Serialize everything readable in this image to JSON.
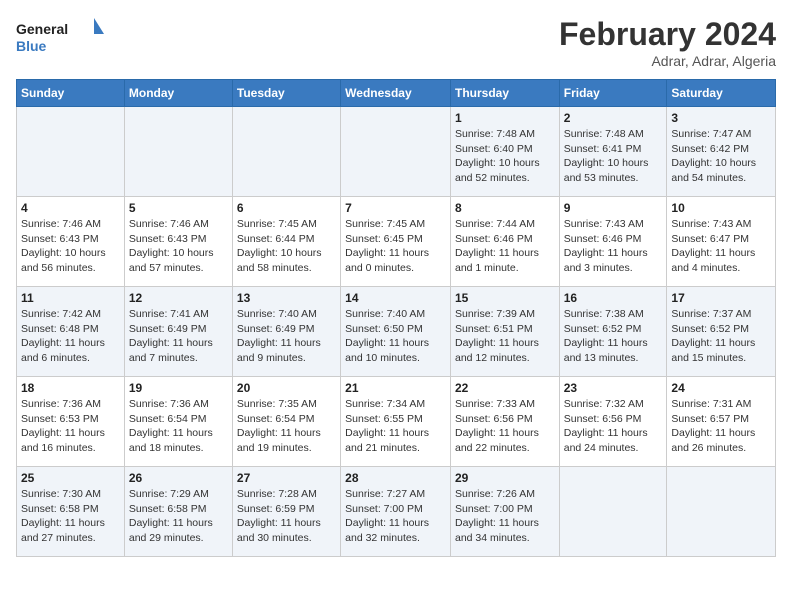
{
  "header": {
    "logo_text_general": "General",
    "logo_text_blue": "Blue",
    "month_title": "February 2024",
    "location": "Adrar, Adrar, Algeria"
  },
  "days_of_week": [
    "Sunday",
    "Monday",
    "Tuesday",
    "Wednesday",
    "Thursday",
    "Friday",
    "Saturday"
  ],
  "weeks": [
    [
      {
        "day": "",
        "info": ""
      },
      {
        "day": "",
        "info": ""
      },
      {
        "day": "",
        "info": ""
      },
      {
        "day": "",
        "info": ""
      },
      {
        "day": "1",
        "info": "Sunrise: 7:48 AM\nSunset: 6:40 PM\nDaylight: 10 hours and 52 minutes."
      },
      {
        "day": "2",
        "info": "Sunrise: 7:48 AM\nSunset: 6:41 PM\nDaylight: 10 hours and 53 minutes."
      },
      {
        "day": "3",
        "info": "Sunrise: 7:47 AM\nSunset: 6:42 PM\nDaylight: 10 hours and 54 minutes."
      }
    ],
    [
      {
        "day": "4",
        "info": "Sunrise: 7:46 AM\nSunset: 6:43 PM\nDaylight: 10 hours and 56 minutes."
      },
      {
        "day": "5",
        "info": "Sunrise: 7:46 AM\nSunset: 6:43 PM\nDaylight: 10 hours and 57 minutes."
      },
      {
        "day": "6",
        "info": "Sunrise: 7:45 AM\nSunset: 6:44 PM\nDaylight: 10 hours and 58 minutes."
      },
      {
        "day": "7",
        "info": "Sunrise: 7:45 AM\nSunset: 6:45 PM\nDaylight: 11 hours and 0 minutes."
      },
      {
        "day": "8",
        "info": "Sunrise: 7:44 AM\nSunset: 6:46 PM\nDaylight: 11 hours and 1 minute."
      },
      {
        "day": "9",
        "info": "Sunrise: 7:43 AM\nSunset: 6:46 PM\nDaylight: 11 hours and 3 minutes."
      },
      {
        "day": "10",
        "info": "Sunrise: 7:43 AM\nSunset: 6:47 PM\nDaylight: 11 hours and 4 minutes."
      }
    ],
    [
      {
        "day": "11",
        "info": "Sunrise: 7:42 AM\nSunset: 6:48 PM\nDaylight: 11 hours and 6 minutes."
      },
      {
        "day": "12",
        "info": "Sunrise: 7:41 AM\nSunset: 6:49 PM\nDaylight: 11 hours and 7 minutes."
      },
      {
        "day": "13",
        "info": "Sunrise: 7:40 AM\nSunset: 6:49 PM\nDaylight: 11 hours and 9 minutes."
      },
      {
        "day": "14",
        "info": "Sunrise: 7:40 AM\nSunset: 6:50 PM\nDaylight: 11 hours and 10 minutes."
      },
      {
        "day": "15",
        "info": "Sunrise: 7:39 AM\nSunset: 6:51 PM\nDaylight: 11 hours and 12 minutes."
      },
      {
        "day": "16",
        "info": "Sunrise: 7:38 AM\nSunset: 6:52 PM\nDaylight: 11 hours and 13 minutes."
      },
      {
        "day": "17",
        "info": "Sunrise: 7:37 AM\nSunset: 6:52 PM\nDaylight: 11 hours and 15 minutes."
      }
    ],
    [
      {
        "day": "18",
        "info": "Sunrise: 7:36 AM\nSunset: 6:53 PM\nDaylight: 11 hours and 16 minutes."
      },
      {
        "day": "19",
        "info": "Sunrise: 7:36 AM\nSunset: 6:54 PM\nDaylight: 11 hours and 18 minutes."
      },
      {
        "day": "20",
        "info": "Sunrise: 7:35 AM\nSunset: 6:54 PM\nDaylight: 11 hours and 19 minutes."
      },
      {
        "day": "21",
        "info": "Sunrise: 7:34 AM\nSunset: 6:55 PM\nDaylight: 11 hours and 21 minutes."
      },
      {
        "day": "22",
        "info": "Sunrise: 7:33 AM\nSunset: 6:56 PM\nDaylight: 11 hours and 22 minutes."
      },
      {
        "day": "23",
        "info": "Sunrise: 7:32 AM\nSunset: 6:56 PM\nDaylight: 11 hours and 24 minutes."
      },
      {
        "day": "24",
        "info": "Sunrise: 7:31 AM\nSunset: 6:57 PM\nDaylight: 11 hours and 26 minutes."
      }
    ],
    [
      {
        "day": "25",
        "info": "Sunrise: 7:30 AM\nSunset: 6:58 PM\nDaylight: 11 hours and 27 minutes."
      },
      {
        "day": "26",
        "info": "Sunrise: 7:29 AM\nSunset: 6:58 PM\nDaylight: 11 hours and 29 minutes."
      },
      {
        "day": "27",
        "info": "Sunrise: 7:28 AM\nSunset: 6:59 PM\nDaylight: 11 hours and 30 minutes."
      },
      {
        "day": "28",
        "info": "Sunrise: 7:27 AM\nSunset: 7:00 PM\nDaylight: 11 hours and 32 minutes."
      },
      {
        "day": "29",
        "info": "Sunrise: 7:26 AM\nSunset: 7:00 PM\nDaylight: 11 hours and 34 minutes."
      },
      {
        "day": "",
        "info": ""
      },
      {
        "day": "",
        "info": ""
      }
    ]
  ]
}
